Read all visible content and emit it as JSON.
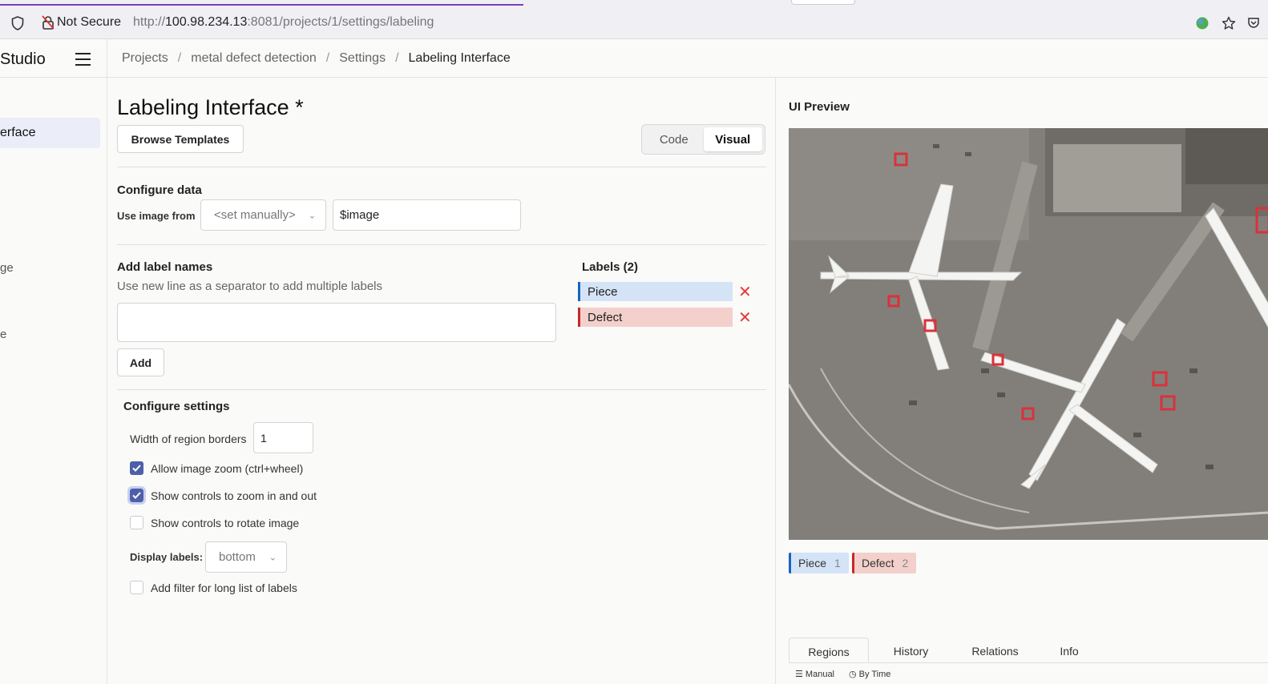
{
  "browser": {
    "not_secure": "Not Secure",
    "url_scheme": "http://",
    "url_host": "100.98.234.13",
    "url_rest": ":8081/projects/1/settings/labeling"
  },
  "header": {
    "brand": "Studio",
    "breadcrumb": [
      "Projects",
      "metal defect detection",
      "Settings",
      "Labeling Interface"
    ],
    "breadcrumb_sep": "/"
  },
  "sidebar": {
    "active": "erface",
    "items": [
      "ge",
      "e"
    ]
  },
  "main": {
    "title": "Labeling Interface *",
    "browse_templates": "Browse Templates",
    "mode_tabs": [
      "Code",
      "Visual"
    ],
    "configure_data": {
      "title": "Configure data",
      "use_image_from": "Use image from",
      "source_select": "<set manually>",
      "source_value": "$image"
    },
    "add_labels": {
      "title": "Add label names",
      "hint": "Use new line as a separator to add multiple labels",
      "add_button": "Add"
    },
    "labels": {
      "title": "Labels (2)",
      "items": [
        {
          "name": "Piece",
          "color": "#1565c0",
          "bg": "#d4e3f5"
        },
        {
          "name": "Defect",
          "color": "#c62828",
          "bg": "#f3d0cb"
        }
      ]
    },
    "settings": {
      "title": "Configure settings",
      "border_width_label": "Width of region borders",
      "border_width_value": "1",
      "zoom": "Allow image zoom (ctrl+wheel)",
      "zoom_controls": "Show controls to zoom in and out",
      "rotate_controls": "Show controls to rotate image",
      "display_labels": "Display labels:",
      "display_labels_value": "bottom",
      "filter": "Add filter for long list of labels"
    }
  },
  "preview": {
    "title": "UI Preview",
    "chips": [
      {
        "name": "Piece",
        "count": "1"
      },
      {
        "name": "Defect",
        "count": "2"
      }
    ],
    "tabs": [
      "Regions",
      "History",
      "Relations",
      "Info"
    ],
    "sub": [
      "Manual",
      "By Time"
    ]
  }
}
